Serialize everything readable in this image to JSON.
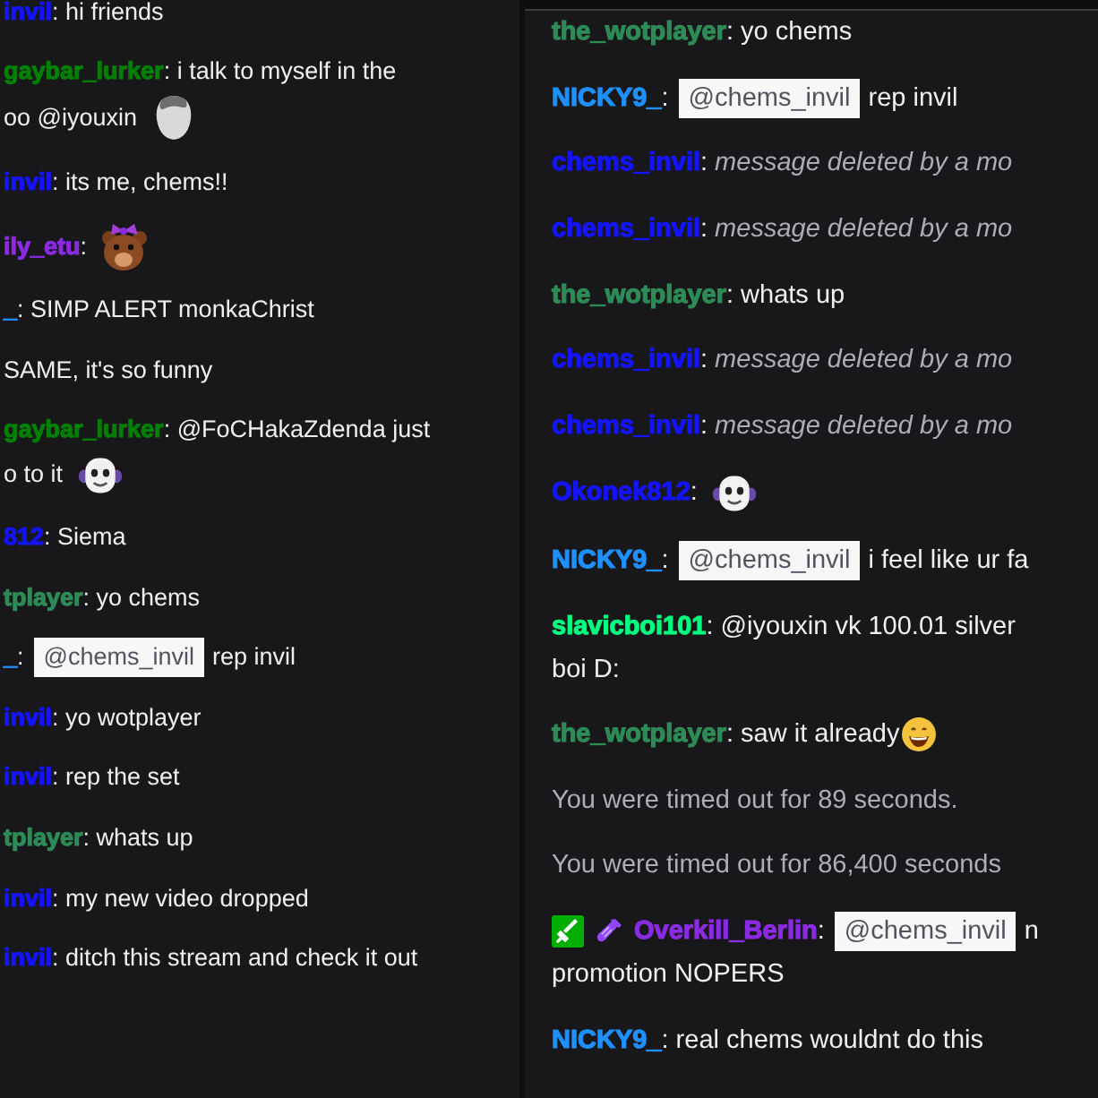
{
  "left_chat": {
    "messages": [
      {
        "kind": "message",
        "user": "invil",
        "color": "#1414ff",
        "lines": [
          [
            {
              "kind": "text",
              "text": ": hi friends"
            }
          ]
        ]
      },
      {
        "kind": "message",
        "user": "gaybar_lurker",
        "color": "#008000",
        "lines": [
          [
            {
              "kind": "text",
              "text": ": i talk to myself in the"
            }
          ],
          [
            {
              "kind": "text",
              "text": "oo @iyouxin"
            },
            {
              "kind": "head_emote"
            }
          ]
        ]
      },
      {
        "kind": "message",
        "user": "invil",
        "color": "#1414ff",
        "lines": [
          [
            {
              "kind": "text",
              "text": ": its me, chems!!"
            }
          ]
        ]
      },
      {
        "kind": "message",
        "user": "ily_etu",
        "color": "#8a2be2",
        "lines": [
          [
            {
              "kind": "text",
              "text": ":"
            },
            {
              "kind": "bear_emote"
            }
          ]
        ]
      },
      {
        "kind": "message",
        "user": "_",
        "color": "#1e90ff",
        "lines": [
          [
            {
              "kind": "text",
              "text": ": SIMP ALERT monkaChrist"
            }
          ]
        ]
      },
      {
        "kind": "message",
        "lines": [
          [
            {
              "kind": "text",
              "text": "SAME, it's so funny"
            }
          ]
        ]
      },
      {
        "kind": "message",
        "user": "gaybar_lurker",
        "color": "#008000",
        "lines": [
          [
            {
              "kind": "text",
              "text": ": @FoCHakaZdenda just"
            }
          ],
          [
            {
              "kind": "text",
              "text": "o to it"
            },
            {
              "kind": "mask_emote"
            }
          ]
        ]
      },
      {
        "kind": "message",
        "user": "812",
        "color": "#1414ff",
        "lines": [
          [
            {
              "kind": "text",
              "text": ": Siema"
            }
          ]
        ]
      },
      {
        "kind": "message",
        "user": "tplayer",
        "color": "#2e8b57",
        "lines": [
          [
            {
              "kind": "text",
              "text": ": yo chems"
            }
          ]
        ]
      },
      {
        "kind": "message",
        "user": "_",
        "color": "#1e90ff",
        "lines": [
          [
            {
              "kind": "text",
              "text": ":"
            },
            {
              "kind": "mention",
              "text": "@chems_invil"
            },
            {
              "kind": "text",
              "text": "rep invil"
            }
          ]
        ]
      },
      {
        "kind": "message",
        "user": "invil",
        "color": "#1414ff",
        "lines": [
          [
            {
              "kind": "text",
              "text": ": yo wotplayer"
            }
          ]
        ]
      },
      {
        "kind": "message",
        "user": "invil",
        "color": "#1414ff",
        "lines": [
          [
            {
              "kind": "text",
              "text": ": rep the set"
            }
          ]
        ]
      },
      {
        "kind": "message",
        "user": "tplayer",
        "color": "#2e8b57",
        "lines": [
          [
            {
              "kind": "text",
              "text": ": whats up"
            }
          ]
        ]
      },
      {
        "kind": "message",
        "user": "invil",
        "color": "#1414ff",
        "lines": [
          [
            {
              "kind": "text",
              "text": ": my new video dropped"
            }
          ]
        ]
      },
      {
        "kind": "message",
        "user": "invil",
        "color": "#1414ff",
        "lines": [
          [
            {
              "kind": "text",
              "text": ": ditch this stream and check it out"
            }
          ]
        ]
      }
    ]
  },
  "right_chat": {
    "messages": [
      {
        "kind": "message",
        "user": "the_wotplayer",
        "color": "#2e8b57",
        "lines": [
          [
            {
              "kind": "text",
              "text": ": yo chems"
            }
          ]
        ]
      },
      {
        "kind": "message",
        "user": "NICKY9_",
        "color": "#1e90ff",
        "lines": [
          [
            {
              "kind": "text",
              "text": ":"
            },
            {
              "kind": "mention",
              "text": "@chems_invil"
            },
            {
              "kind": "text",
              "text": "rep invil"
            }
          ]
        ]
      },
      {
        "kind": "message",
        "user": "chems_invil",
        "color": "#1414ff",
        "lines": [
          [
            {
              "kind": "text",
              "text": ":"
            },
            {
              "kind": "deleted",
              "text": "message deleted by a mo"
            }
          ]
        ]
      },
      {
        "kind": "message",
        "user": "chems_invil",
        "color": "#1414ff",
        "lines": [
          [
            {
              "kind": "text",
              "text": ":"
            },
            {
              "kind": "deleted",
              "text": "message deleted by a mo"
            }
          ]
        ]
      },
      {
        "kind": "message",
        "user": "the_wotplayer",
        "color": "#2e8b57",
        "lines": [
          [
            {
              "kind": "text",
              "text": ": whats up"
            }
          ]
        ]
      },
      {
        "kind": "message",
        "user": "chems_invil",
        "color": "#1414ff",
        "lines": [
          [
            {
              "kind": "text",
              "text": ":"
            },
            {
              "kind": "deleted",
              "text": "message deleted by a mo"
            }
          ]
        ]
      },
      {
        "kind": "message",
        "user": "chems_invil",
        "color": "#1414ff",
        "lines": [
          [
            {
              "kind": "text",
              "text": ":"
            },
            {
              "kind": "deleted",
              "text": "message deleted by a mo"
            }
          ]
        ]
      },
      {
        "kind": "message",
        "user": "Okonek812",
        "color": "#1414ff",
        "lines": [
          [
            {
              "kind": "text",
              "text": ":"
            },
            {
              "kind": "mask_emote"
            }
          ]
        ]
      },
      {
        "kind": "message",
        "user": "NICKY9_",
        "color": "#1e90ff",
        "lines": [
          [
            {
              "kind": "text",
              "text": ":"
            },
            {
              "kind": "mention",
              "text": "@chems_invil"
            },
            {
              "kind": "text",
              "text": "i feel like ur fa"
            }
          ]
        ]
      },
      {
        "kind": "message",
        "user": "slavicboi101",
        "color": "#00ff7f",
        "lines": [
          [
            {
              "kind": "text",
              "text": ": @iyouxin vk 100.01 silver"
            }
          ],
          [
            {
              "kind": "text",
              "text": "boi D:"
            }
          ]
        ]
      },
      {
        "kind": "message",
        "user": "the_wotplayer",
        "color": "#2e8b57",
        "lines": [
          [
            {
              "kind": "text",
              "text": ": saw it already"
            },
            {
              "kind": "grin_emoji"
            }
          ]
        ]
      },
      {
        "kind": "system",
        "text": "You were timed out for 89 seconds."
      },
      {
        "kind": "system",
        "text": "You were timed out for 86,400 seconds"
      },
      {
        "kind": "message",
        "user": "Overkill_Berlin",
        "color": "#8a2be2",
        "badges": [
          {
            "kind": "sword"
          },
          {
            "kind": "bottle"
          }
        ],
        "lines": [
          [
            {
              "kind": "text",
              "text": ":"
            },
            {
              "kind": "mention",
              "text": "@chems_invil"
            },
            {
              "kind": "text",
              "text": "n"
            }
          ],
          [
            {
              "kind": "text",
              "text": "promotion NOPERS"
            }
          ]
        ]
      },
      {
        "kind": "message",
        "user": "NICKY9_",
        "color": "#1e90ff",
        "lines": [
          [
            {
              "kind": "text",
              "text": ": real chems wouldnt do this"
            }
          ]
        ]
      }
    ]
  }
}
